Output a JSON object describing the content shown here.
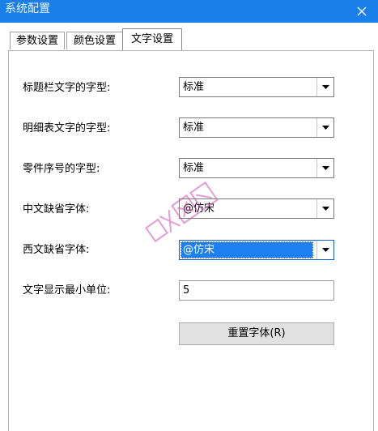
{
  "window": {
    "title": "系统配置"
  },
  "tabs": [
    {
      "label": "参数设置",
      "active": false
    },
    {
      "label": "颜色设置",
      "active": false
    },
    {
      "label": "文字设置",
      "active": true
    }
  ],
  "settings": {
    "title_font": {
      "label": "标题栏文字的字型:",
      "value": "标准"
    },
    "detail_font": {
      "label": "明细表文字的字型:",
      "value": "标准"
    },
    "part_number_font": {
      "label": "零件序号的字型:",
      "value": "标准"
    },
    "chinese_default_font": {
      "label": "中文缺省字体:",
      "value": "@仿宋"
    },
    "western_default_font": {
      "label": "西文缺省字体:",
      "value": "@仿宋"
    },
    "min_text_unit": {
      "label": "文字显示最小单位:",
      "value": "5"
    }
  },
  "reset_button": {
    "label": "重置字体(R)"
  },
  "colors": {
    "titlebar": "#1a7fe8",
    "selection": "#1e7ff0",
    "watermark": "#d04bb8"
  }
}
